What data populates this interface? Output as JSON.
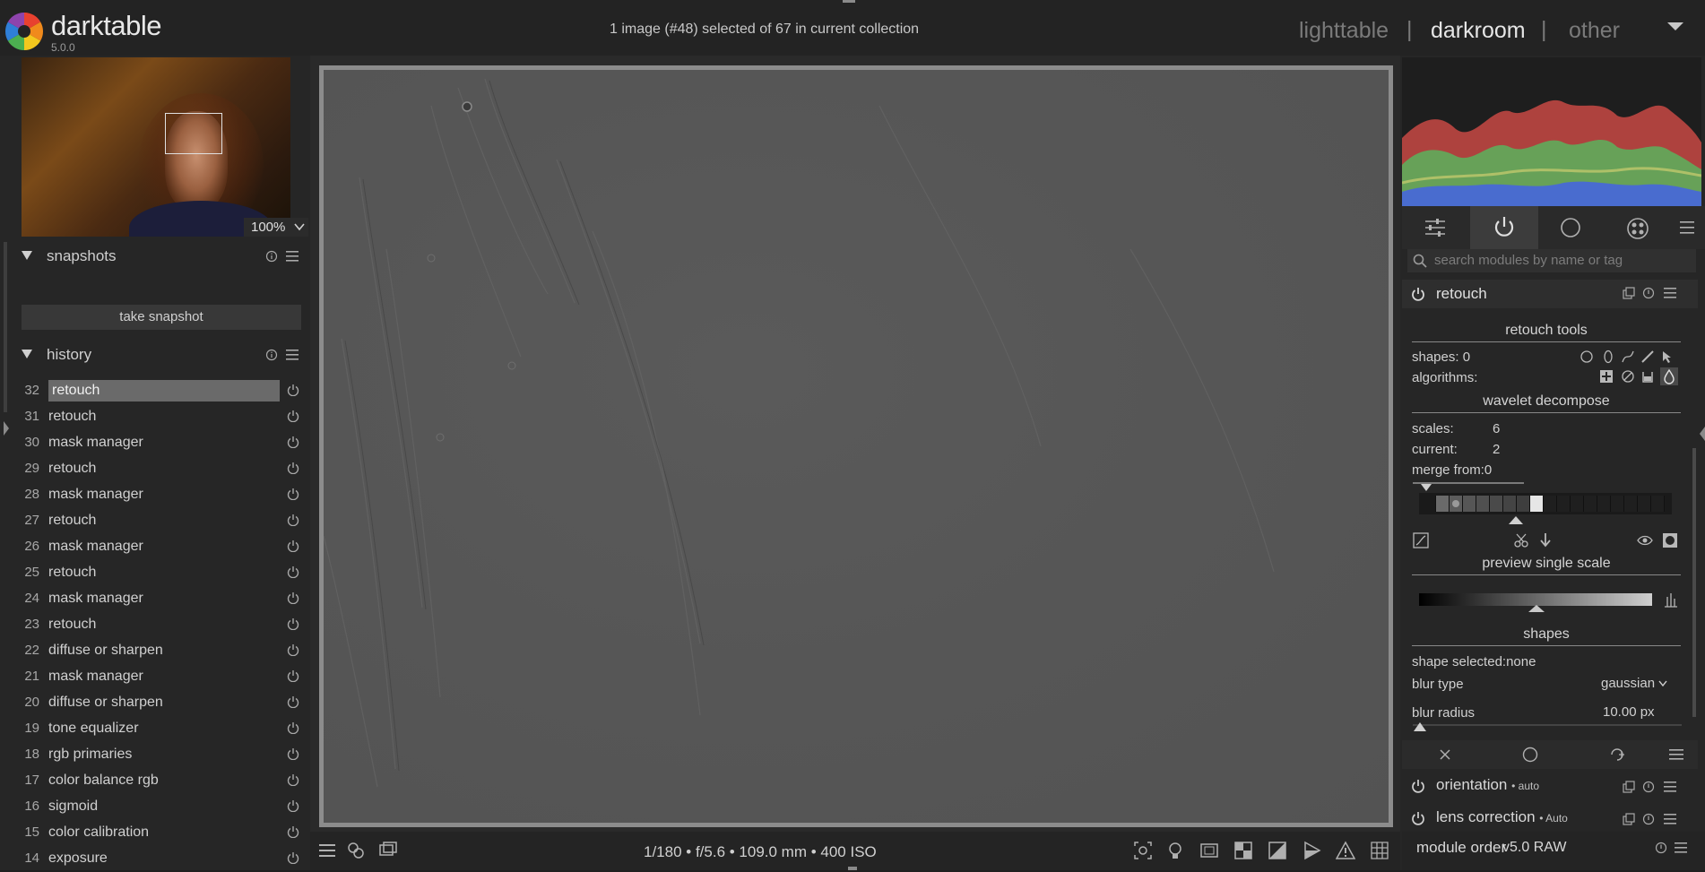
{
  "app": {
    "name": "darktable",
    "version": "5.0.0"
  },
  "header": {
    "selection_info": "1 image (#48) selected of 67 in current collection",
    "views": [
      "lighttable",
      "darkroom",
      "other"
    ],
    "separator": "|",
    "active_view": "darkroom"
  },
  "navigator": {
    "zoom": "100%"
  },
  "snapshots": {
    "title": "snapshots",
    "take_snapshot_label": "take snapshot"
  },
  "history": {
    "title": "history",
    "selected": "32",
    "items": [
      {
        "num": "32",
        "label": "retouch"
      },
      {
        "num": "31",
        "label": "retouch"
      },
      {
        "num": "30",
        "label": "mask manager"
      },
      {
        "num": "29",
        "label": "retouch"
      },
      {
        "num": "28",
        "label": "mask manager"
      },
      {
        "num": "27",
        "label": "retouch"
      },
      {
        "num": "26",
        "label": "mask manager"
      },
      {
        "num": "25",
        "label": "retouch"
      },
      {
        "num": "24",
        "label": "mask manager"
      },
      {
        "num": "23",
        "label": "retouch"
      },
      {
        "num": "22",
        "label": "diffuse or sharpen"
      },
      {
        "num": "21",
        "label": "mask manager"
      },
      {
        "num": "20",
        "label": "diffuse or sharpen"
      },
      {
        "num": "19",
        "label": "tone equalizer"
      },
      {
        "num": "18",
        "label": "rgb primaries"
      },
      {
        "num": "17",
        "label": "color balance rgb"
      },
      {
        "num": "16",
        "label": "sigmoid"
      },
      {
        "num": "15",
        "label": "color calibration"
      },
      {
        "num": "14",
        "label": "exposure"
      }
    ]
  },
  "image_info": {
    "exif": "1/180 • f/5.6 • 109.0 mm • 400 ISO"
  },
  "modules": {
    "search_placeholder": "search modules by name or tag",
    "retouch": {
      "title": "retouch",
      "tools_title": "retouch tools",
      "shapes_label": "shapes:",
      "shapes_count": "0",
      "algorithms_label": "algorithms:",
      "wavelet_title": "wavelet decompose",
      "scales_label": "scales:",
      "scales_value": "6",
      "current_label": "current:",
      "current_value": "2",
      "merge_from_label": "merge from:",
      "merge_from_value": "0",
      "preview_title": "preview single scale",
      "shapes_title": "shapes",
      "shape_selected_label": "shape selected:",
      "shape_selected_value": "none",
      "blur_type_label": "blur type",
      "blur_type_value": "gaussian",
      "blur_radius_label": "blur radius",
      "blur_radius_value": "10.00 px"
    },
    "below": [
      {
        "name": "orientation",
        "suffix": "• auto"
      },
      {
        "name": "lens correction",
        "suffix": "• Auto"
      }
    ]
  },
  "footer": {
    "module_order_label": "module order",
    "module_order_value": "v5.0 RAW"
  },
  "colors": {
    "accent_text": "#e6e6e6",
    "panel_bg": "#262626",
    "image_gray": "#565656"
  }
}
